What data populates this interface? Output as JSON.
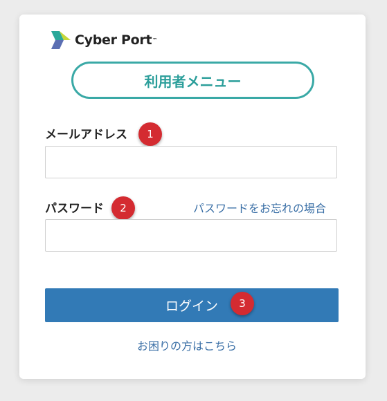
{
  "brand": {
    "name": "Cyber Port",
    "tm": "™"
  },
  "menu": {
    "title": "利用者メニュー"
  },
  "email": {
    "label": "メールアドレス",
    "value": "",
    "placeholder": "",
    "badge": "1"
  },
  "password": {
    "label": "パスワード",
    "value": "",
    "placeholder": "",
    "badge": "2",
    "forgot_link": "パスワードをお忘れの場合"
  },
  "login": {
    "label": "ログイン",
    "badge": "3"
  },
  "help_link": "お困りの方はこちら",
  "colors": {
    "teal": "#3aa9a6",
    "button_blue": "#327ab6",
    "link_blue": "#3a6fa6",
    "badge_red": "#d42b31"
  }
}
